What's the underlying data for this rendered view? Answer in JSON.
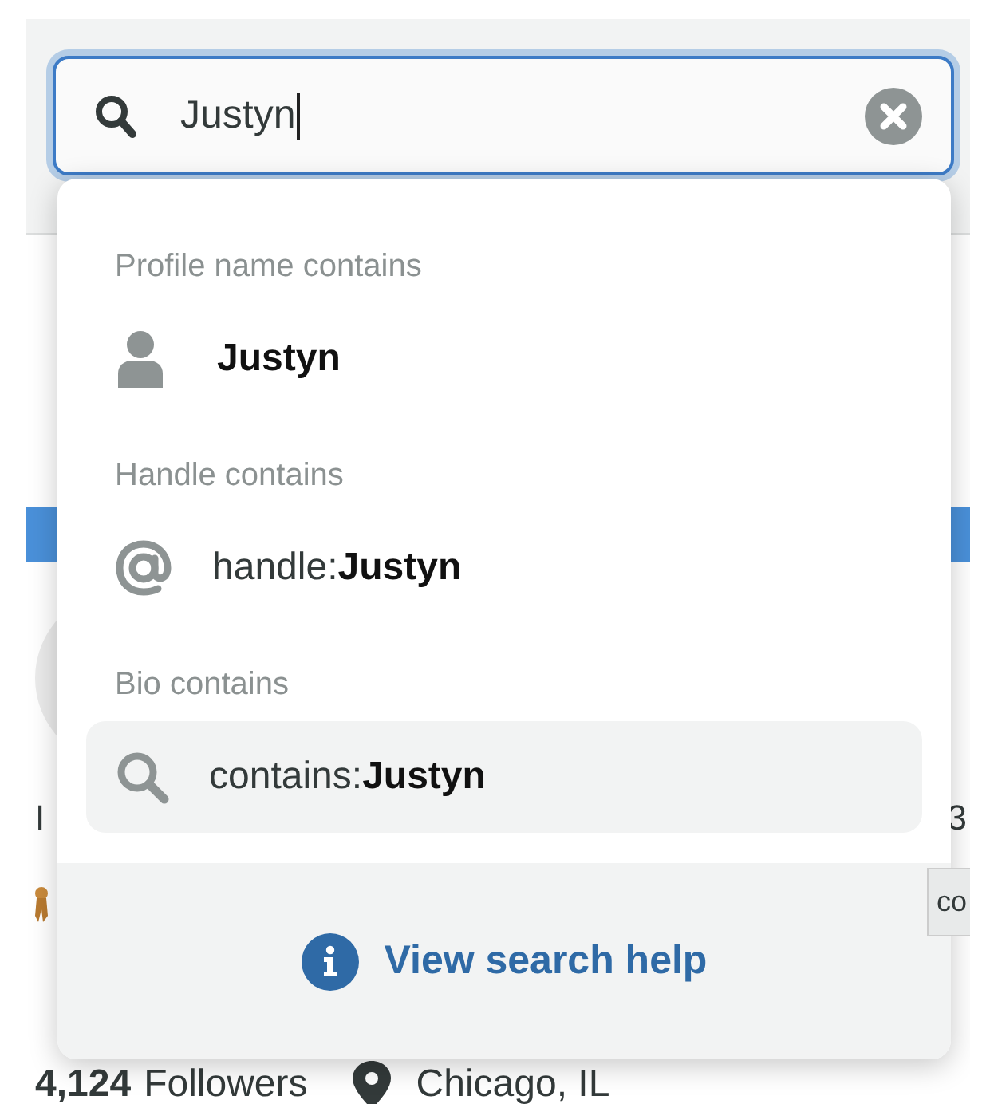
{
  "search": {
    "value": "Justyn",
    "focused": true
  },
  "sections": [
    {
      "heading": "Profile name contains",
      "items": [
        {
          "kind": "profile",
          "term": "Justyn",
          "selected": false
        }
      ]
    },
    {
      "heading": "Handle contains",
      "items": [
        {
          "kind": "handle",
          "prefix": "handle:",
          "term": "Justyn",
          "selected": false
        }
      ]
    },
    {
      "heading": "Bio contains",
      "items": [
        {
          "kind": "bio",
          "prefix": "contains:",
          "term": "Justyn",
          "selected": true
        }
      ]
    }
  ],
  "help_link": "View search help",
  "background": {
    "bio_fragments": [
      "I",
      "3"
    ],
    "tooltip": "co",
    "followers_count": "4,124",
    "followers_label": "Followers",
    "location": "Chicago, IL"
  }
}
